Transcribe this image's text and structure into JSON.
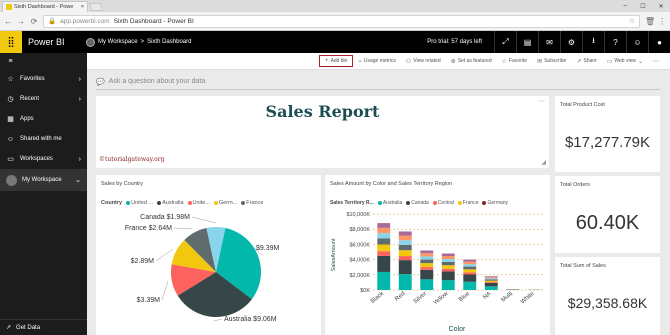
{
  "browser": {
    "tab_title": "Sixth Dashboard - Powe",
    "close_tab": "×",
    "address_prefix": "app.powerbi.com",
    "address_page": "Sixth Dashboard - Power BI",
    "back": "←",
    "forward": "→",
    "refresh": "⟳",
    "window_controls": [
      "–",
      "☐",
      "✕"
    ]
  },
  "header": {
    "brand": "Power BI",
    "workspace": "My Workspace",
    "separator": ">",
    "dashboard": "Sixth Dashboard",
    "trial": "Pro trial: 57 days left"
  },
  "leftnav": {
    "items": [
      {
        "label": "Favorites",
        "icon": "☆"
      },
      {
        "label": "Recent",
        "icon": "◷"
      },
      {
        "label": "Apps",
        "icon": "▦"
      },
      {
        "label": "Shared with me",
        "icon": "☺"
      },
      {
        "label": "Workspaces",
        "icon": "▭"
      }
    ],
    "my_workspace": "My Workspace",
    "get_data": "Get Data"
  },
  "toolbar": {
    "add_tile": "Add tile",
    "usage_metrics": "Usage metrics",
    "view_related": "View related",
    "set_featured": "Set as featured",
    "favorite": "Favorite",
    "subscribe": "Subscribe",
    "share": "Share",
    "web_view": "Web view"
  },
  "qna_placeholder": "Ask a question about your data",
  "tiles": {
    "sales_report": {
      "title": "Sales Report",
      "watermark": "©tutorialgateway.org"
    },
    "total_product_cost": {
      "title": "Total Product Cost",
      "value": "$17,277.79K"
    },
    "total_orders": {
      "title": "Total Orders",
      "value": "60.40K"
    },
    "total_sales": {
      "title": "Total Sum of Sales",
      "value": "$29,358.68K"
    },
    "sales_by_country": {
      "title": "Sales by Country",
      "legend_title": "Country",
      "legend": [
        "United ...",
        "Australia",
        "Unite...",
        "Germ...",
        "France"
      ]
    },
    "sales_by_color": {
      "title": "Sales Amount by Color and Sales Territory Region",
      "legend_title": "Sales Territory R...",
      "legend": [
        "Australia",
        "Canada",
        "Central",
        "France",
        "Germany"
      ]
    }
  },
  "colors": {
    "accent_yellow": "#f2c811",
    "teal": "#01b8aa",
    "dark": "#374649",
    "red": "#fd625e",
    "yellow": "#f2c80f",
    "gray": "#5f6b6d",
    "lightblue": "#8ad4eb",
    "orange": "#fe9666",
    "purple": "#a66999",
    "darkred": "#8b2323",
    "gridline": "#d4a04a"
  },
  "chart_data": [
    {
      "type": "pie",
      "title": "Sales by Country",
      "legend_title": "Country",
      "slices": [
        {
          "label": "$9.39M",
          "value": 9.39,
          "color": "#01b8aa"
        },
        {
          "label": "Australia $9.06M",
          "value": 9.06,
          "color": "#374649"
        },
        {
          "label": "$3.39M",
          "value": 3.39,
          "color": "#fd625e"
        },
        {
          "label": "$2.89M",
          "value": 2.89,
          "color": "#f2c80f"
        },
        {
          "label": "France $2.64M",
          "value": 2.64,
          "color": "#5f6b6d"
        },
        {
          "label": "Canada $1.98M",
          "value": 1.98,
          "color": "#8ad4eb"
        }
      ]
    },
    {
      "type": "bar",
      "title": "Sales Amount by Color and Sales Territory Region",
      "xlabel": "Color",
      "ylabel": "SalesAmount",
      "categories": [
        "Black",
        "Red",
        "Silver",
        "Yellow",
        "Blue",
        "NA",
        "Multi",
        "White"
      ],
      "yticks": [
        "$0K",
        "$2,000K",
        "$4,000K",
        "$6,000K",
        "$8,000K",
        "$10,000K"
      ],
      "ylim": [
        0,
        10000
      ],
      "totals": [
        8800,
        7700,
        5200,
        4800,
        4000,
        1800,
        120,
        60
      ],
      "stack_colors": [
        "#01b8aa",
        "#374649",
        "#fd625e",
        "#f2c80f",
        "#5f6b6d",
        "#8ad4eb",
        "#fe9666",
        "#a66999"
      ],
      "stack_fractions": [
        0.27,
        0.24,
        0.07,
        0.1,
        0.09,
        0.08,
        0.08,
        0.07
      ]
    }
  ]
}
